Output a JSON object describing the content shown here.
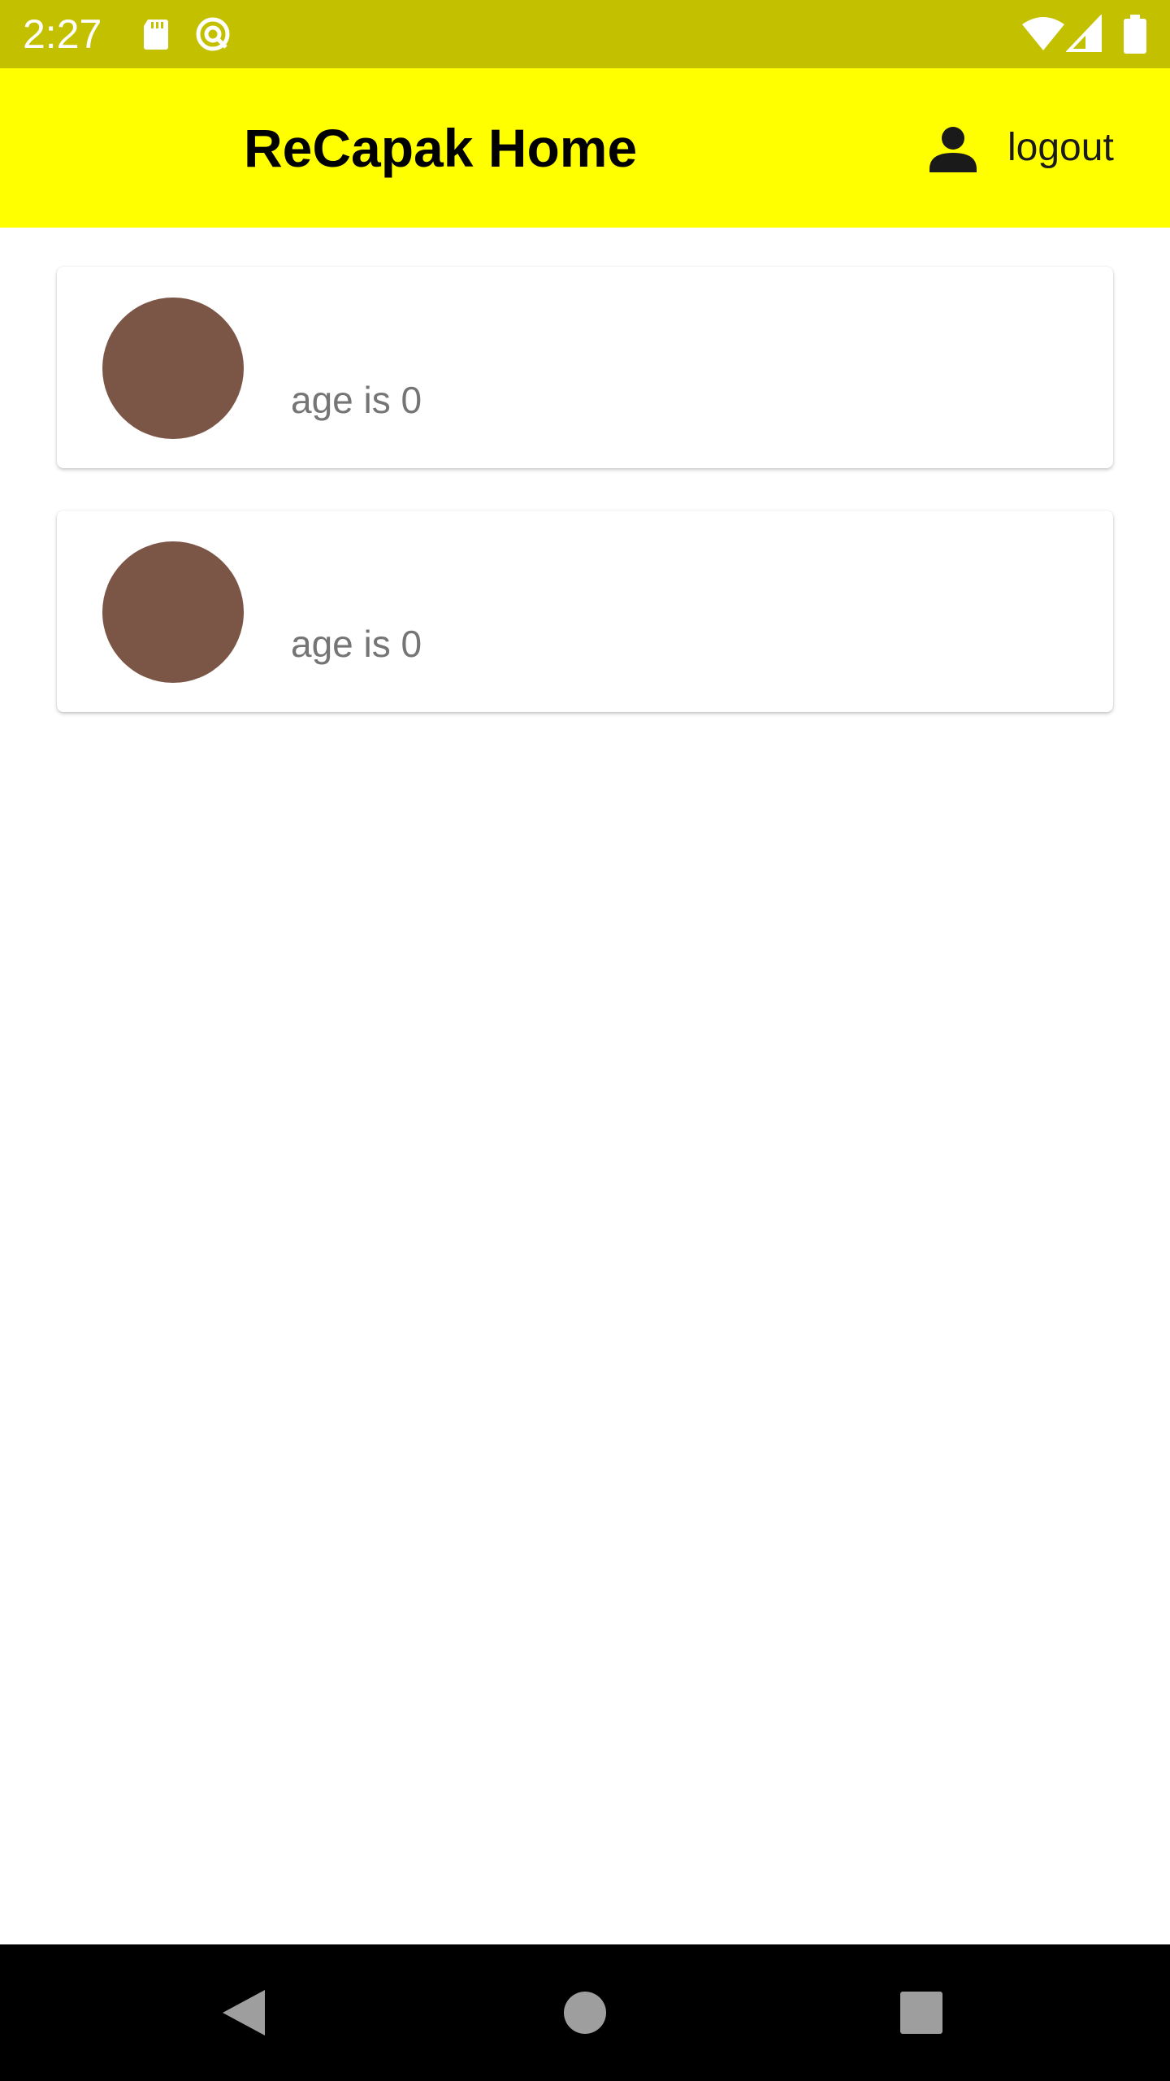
{
  "status_bar": {
    "time": "2:27",
    "icons_left": [
      "sd-card-icon",
      "sync-icon"
    ],
    "icons_right": [
      "wifi-icon",
      "cell-signal-icon",
      "battery-icon"
    ],
    "background": "#c3c000"
  },
  "app_bar": {
    "title": "ReCapak Home",
    "account_icon": "account-icon",
    "logout_label": "logout",
    "background": "#ffff00"
  },
  "list": {
    "items": [
      {
        "name": "",
        "subtitle": "age is 0",
        "avatar_color": "#7b5546"
      },
      {
        "name": "",
        "subtitle": "age is 0",
        "avatar_color": "#7b5546"
      }
    ]
  },
  "nav_bar": {
    "buttons": [
      "back-icon",
      "home-icon",
      "recents-icon"
    ]
  }
}
